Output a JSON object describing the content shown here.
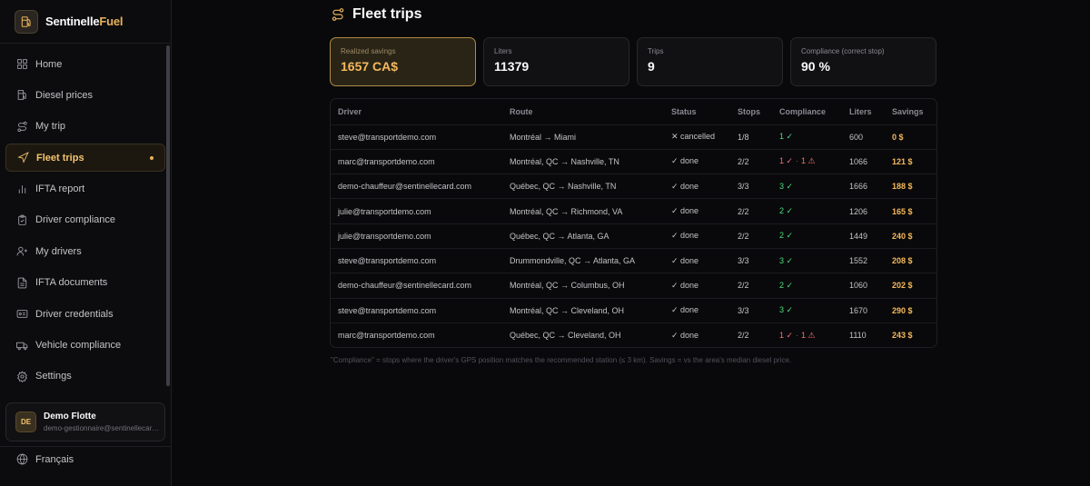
{
  "brand": {
    "name_main": "Sentinelle",
    "name_accent": "Fuel"
  },
  "sidebar": {
    "items": [
      {
        "label": "Home",
        "icon": "grid-icon"
      },
      {
        "label": "Diesel prices",
        "icon": "fuel-pump-icon"
      },
      {
        "label": "My trip",
        "icon": "route-icon"
      },
      {
        "label": "Fleet trips",
        "icon": "navigation-icon",
        "active": true
      },
      {
        "label": "IFTA report",
        "icon": "bar-chart-icon"
      },
      {
        "label": "Driver compliance",
        "icon": "clipboard-check-icon"
      },
      {
        "label": "My drivers",
        "icon": "user-plus-icon"
      },
      {
        "label": "IFTA documents",
        "icon": "file-text-icon"
      },
      {
        "label": "Driver credentials",
        "icon": "id-card-icon"
      },
      {
        "label": "Vehicle compliance",
        "icon": "truck-icon"
      },
      {
        "label": "Settings",
        "icon": "gear-icon"
      }
    ],
    "user": {
      "initials": "DE",
      "name": "Demo Flotte",
      "email": "demo-gestionnaire@sentinellecard.com"
    },
    "language": "Français"
  },
  "page": {
    "title": "Fleet trips"
  },
  "cards": [
    {
      "label": "Realized savings",
      "value": "1657 CA$"
    },
    {
      "label": "Liters",
      "value": "11379"
    },
    {
      "label": "Trips",
      "value": "9"
    },
    {
      "label": "Compliance (correct stop)",
      "value": "90 %"
    }
  ],
  "table": {
    "headers": [
      "Driver",
      "Route",
      "Status",
      "Stops",
      "Compliance",
      "Liters",
      "Savings"
    ],
    "rows": [
      {
        "driver": "steve@transportdemo.com",
        "route": "Montréal → Miami",
        "status": "✕ cancelled",
        "stops": "1/8",
        "ok": "1 ✓",
        "bad": "",
        "liters": "600",
        "savings": "0 $"
      },
      {
        "driver": "marc@transportdemo.com",
        "route": "Montréal, QC → Nashville, TN",
        "status": "✓ done",
        "stops": "2/2",
        "ok": "1 ✓",
        "bad": "1 ⚠",
        "liters": "1066",
        "savings": "121 $"
      },
      {
        "driver": "demo-chauffeur@sentinellecard.com",
        "route": "Québec, QC → Nashville, TN",
        "status": "✓ done",
        "stops": "3/3",
        "ok": "3 ✓",
        "bad": "",
        "liters": "1666",
        "savings": "188 $"
      },
      {
        "driver": "julie@transportdemo.com",
        "route": "Montréal, QC → Richmond, VA",
        "status": "✓ done",
        "stops": "2/2",
        "ok": "2 ✓",
        "bad": "",
        "liters": "1206",
        "savings": "165 $"
      },
      {
        "driver": "julie@transportdemo.com",
        "route": "Québec, QC → Atlanta, GA",
        "status": "✓ done",
        "stops": "2/2",
        "ok": "2 ✓",
        "bad": "",
        "liters": "1449",
        "savings": "240 $"
      },
      {
        "driver": "steve@transportdemo.com",
        "route": "Drummondville, QC → Atlanta, GA",
        "status": "✓ done",
        "stops": "3/3",
        "ok": "3 ✓",
        "bad": "",
        "liters": "1552",
        "savings": "208 $"
      },
      {
        "driver": "demo-chauffeur@sentinellecard.com",
        "route": "Montréal, QC → Columbus, OH",
        "status": "✓ done",
        "stops": "2/2",
        "ok": "2 ✓",
        "bad": "",
        "liters": "1060",
        "savings": "202 $"
      },
      {
        "driver": "steve@transportdemo.com",
        "route": "Montréal, QC → Cleveland, OH",
        "status": "✓ done",
        "stops": "3/3",
        "ok": "3 ✓",
        "bad": "",
        "liters": "1670",
        "savings": "290 $"
      },
      {
        "driver": "marc@transportdemo.com",
        "route": "Québec, QC → Cleveland, OH",
        "status": "✓ done",
        "stops": "2/2",
        "ok": "1 ✓",
        "bad": "1 ⚠",
        "liters": "1110",
        "savings": "243 $"
      }
    ]
  },
  "footnote": "\"Compliance\" = stops where the driver's GPS position matches the recommended station (≤ 3 km). Savings = vs the area's median diesel price.",
  "colors": {
    "accent": "#e8b25c",
    "ok": "#4ade80",
    "bad": "#f87171",
    "background": "#09090b"
  }
}
